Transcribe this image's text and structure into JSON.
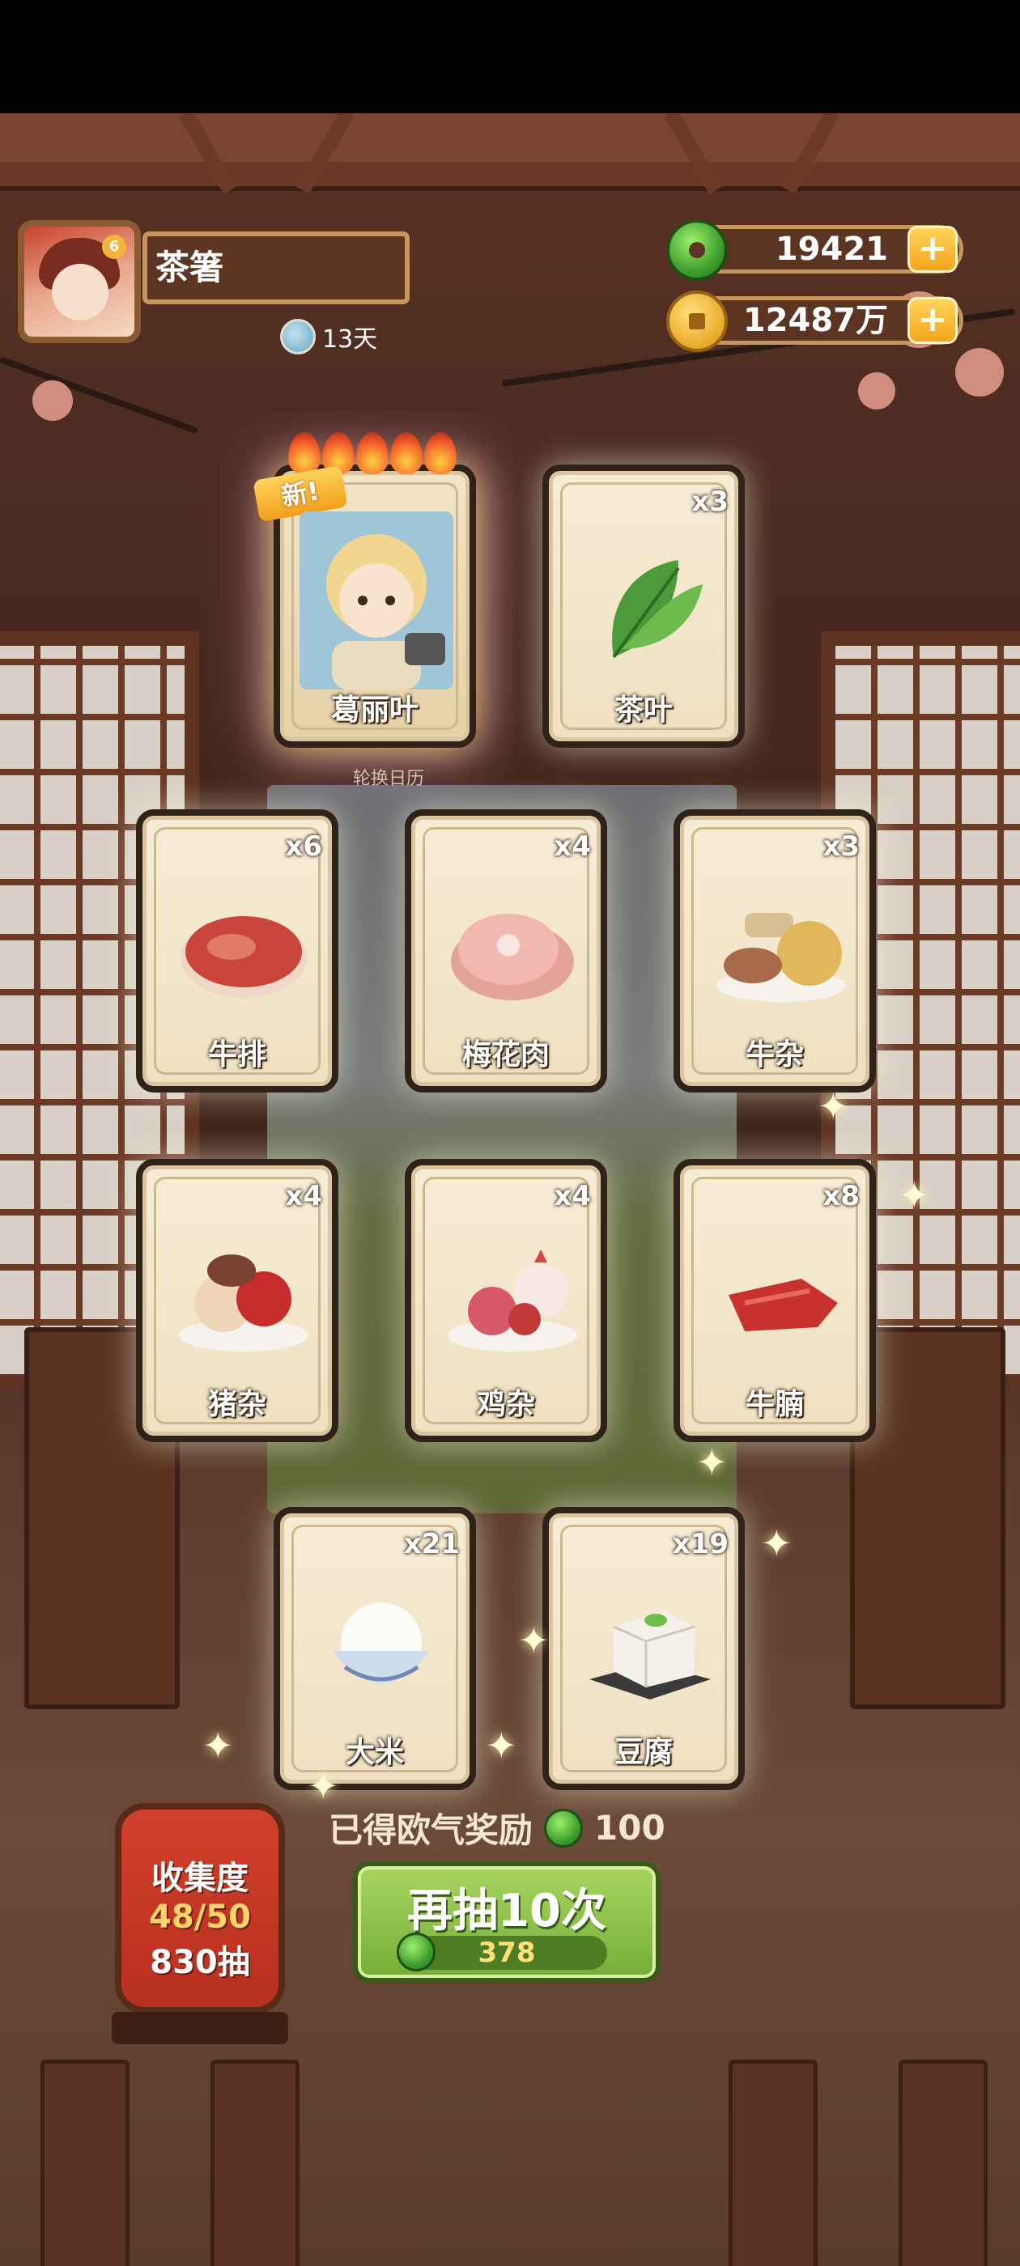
{
  "player": {
    "name": "茶箸",
    "days": "13天"
  },
  "currency": {
    "jade": "19421",
    "coins": "12487万"
  },
  "featured_cards": [
    {
      "name": "葛丽叶",
      "count": "",
      "new_tag": "新!",
      "art": "character"
    },
    {
      "name": "茶叶",
      "count": "x3",
      "art": "tea"
    }
  ],
  "rotate_label": "轮换日历",
  "cards": [
    {
      "name": "牛排",
      "count": "x6",
      "art": "steak"
    },
    {
      "name": "梅花肉",
      "count": "x4",
      "art": "pork"
    },
    {
      "name": "牛杂",
      "count": "x3",
      "art": "offal"
    },
    {
      "name": "猪杂",
      "count": "x4",
      "art": "pig-offal"
    },
    {
      "name": "鸡杂",
      "count": "x4",
      "art": "chicken"
    },
    {
      "name": "牛腩",
      "count": "x8",
      "art": "brisket"
    },
    {
      "name": "大米",
      "count": "x21",
      "art": "rice"
    },
    {
      "name": "豆腐",
      "count": "x19",
      "art": "tofu"
    }
  ],
  "reward": {
    "text": "已得欧气奖励",
    "amount": "100"
  },
  "collection": {
    "title": "收集度",
    "progress": "48/50",
    "draws": "830抽"
  },
  "draw_button": {
    "label": "再抽10次",
    "cost": "378"
  },
  "colors": {
    "accent_green": "#74ad37",
    "plus_gold": "#f4a51d",
    "card_bg": "#f6ecd6",
    "lantern_red": "#c8392a"
  }
}
